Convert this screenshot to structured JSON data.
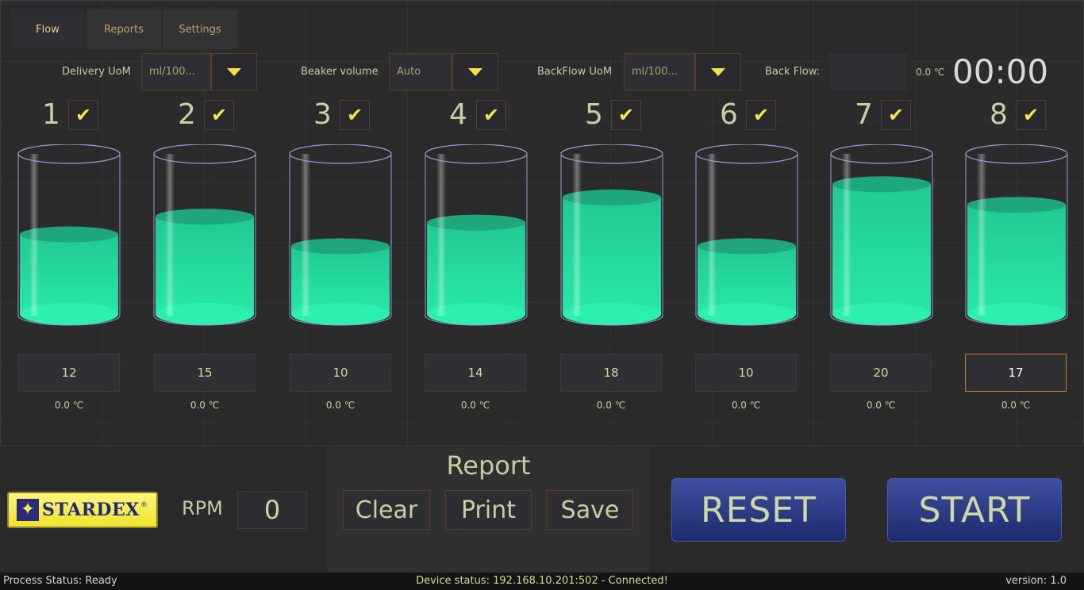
{
  "tabs": [
    {
      "label": "Flow",
      "active": true
    },
    {
      "label": "Reports",
      "active": false
    },
    {
      "label": "Settings",
      "active": false
    }
  ],
  "controls": {
    "delivery_uom_label": "Delivery UoM",
    "delivery_uom_value": "ml/100...",
    "beaker_volume_label": "Beaker volume",
    "beaker_volume_value": "Auto",
    "backflow_uom_label": "BackFlow UoM",
    "backflow_uom_value": "ml/100...",
    "back_flow_label": "Back Flow:",
    "back_flow_value": "",
    "back_flow_temp": "0.0 ℃",
    "timer": "00:00"
  },
  "beakers": [
    {
      "number": "1",
      "checked": true,
      "value": "12",
      "temp": "0.0 ℃",
      "fill_fraction": 0.54
    },
    {
      "number": "2",
      "checked": true,
      "value": "15",
      "temp": "0.0 ℃",
      "fill_fraction": 0.66
    },
    {
      "number": "3",
      "checked": true,
      "value": "10",
      "temp": "0.0 ℃",
      "fill_fraction": 0.46
    },
    {
      "number": "4",
      "checked": true,
      "value": "14",
      "temp": "0.0 ℃",
      "fill_fraction": 0.62
    },
    {
      "number": "5",
      "checked": true,
      "value": "18",
      "temp": "0.0 ℃",
      "fill_fraction": 0.79
    },
    {
      "number": "6",
      "checked": true,
      "value": "10",
      "temp": "0.0 ℃",
      "fill_fraction": 0.46
    },
    {
      "number": "7",
      "checked": true,
      "value": "20",
      "temp": "0.0 ℃",
      "fill_fraction": 0.88
    },
    {
      "number": "8",
      "checked": true,
      "value": "17",
      "temp": "0.0 ℃",
      "fill_fraction": 0.74
    }
  ],
  "bottom": {
    "logo_text": "STARDEX",
    "logo_mark": "®",
    "rpm_label": "RPM",
    "rpm_value": "0",
    "report_title": "Report",
    "clear_label": "Clear",
    "print_label": "Print",
    "save_label": "Save",
    "reset_label": "RESET",
    "start_label": "START"
  },
  "status": {
    "process": "Process Status: Ready",
    "device": "Device status: 192.168.10.201:502 - Connected!",
    "version": "version: 1.0"
  },
  "colors": {
    "liquid": "#22d79a",
    "liquid_top": "#1ea67d",
    "accent": "#f4e04a",
    "button_blue": "#2a3a8a"
  }
}
